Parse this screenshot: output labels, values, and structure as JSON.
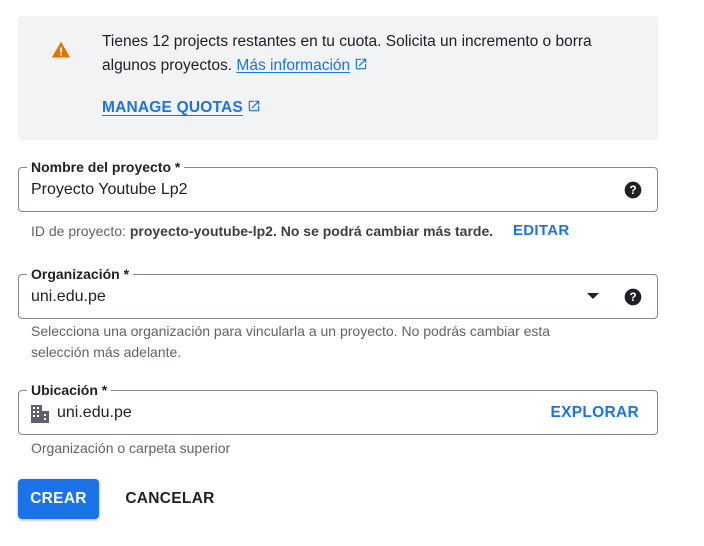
{
  "alert": {
    "icon": "warning-icon",
    "text": "Tienes 12 projects restantes en tu cuota. Solicita un incremento o borra algunos proyectos.",
    "more_info_link": "Más información",
    "manage_link": "MANAGE QUOTAS"
  },
  "project_name": {
    "label": "Nombre del proyecto *",
    "value": "Proyecto Youtube Lp2",
    "help_icon": "help-icon"
  },
  "project_id": {
    "prefix": "ID de proyecto:",
    "id": "proyecto-youtube-lp2.",
    "note": "No se podrá cambiar más tarde.",
    "edit_label": "EDITAR"
  },
  "organization": {
    "label": "Organización *",
    "value": "uni.edu.pe",
    "hint": "Selecciona una organización para vincularla a un proyecto. No podrás cambiar esta selección más adelante."
  },
  "location": {
    "label": "Ubicación *",
    "value": "uni.edu.pe",
    "browse_label": "EXPLORAR",
    "hint": "Organización o carpeta superior"
  },
  "actions": {
    "create_label": "CREAR",
    "cancel_label": "CANCELAR"
  },
  "colors": {
    "accent": "#1a73e8",
    "warning": "#e37400",
    "alert_bg": "#f1f3f4"
  }
}
